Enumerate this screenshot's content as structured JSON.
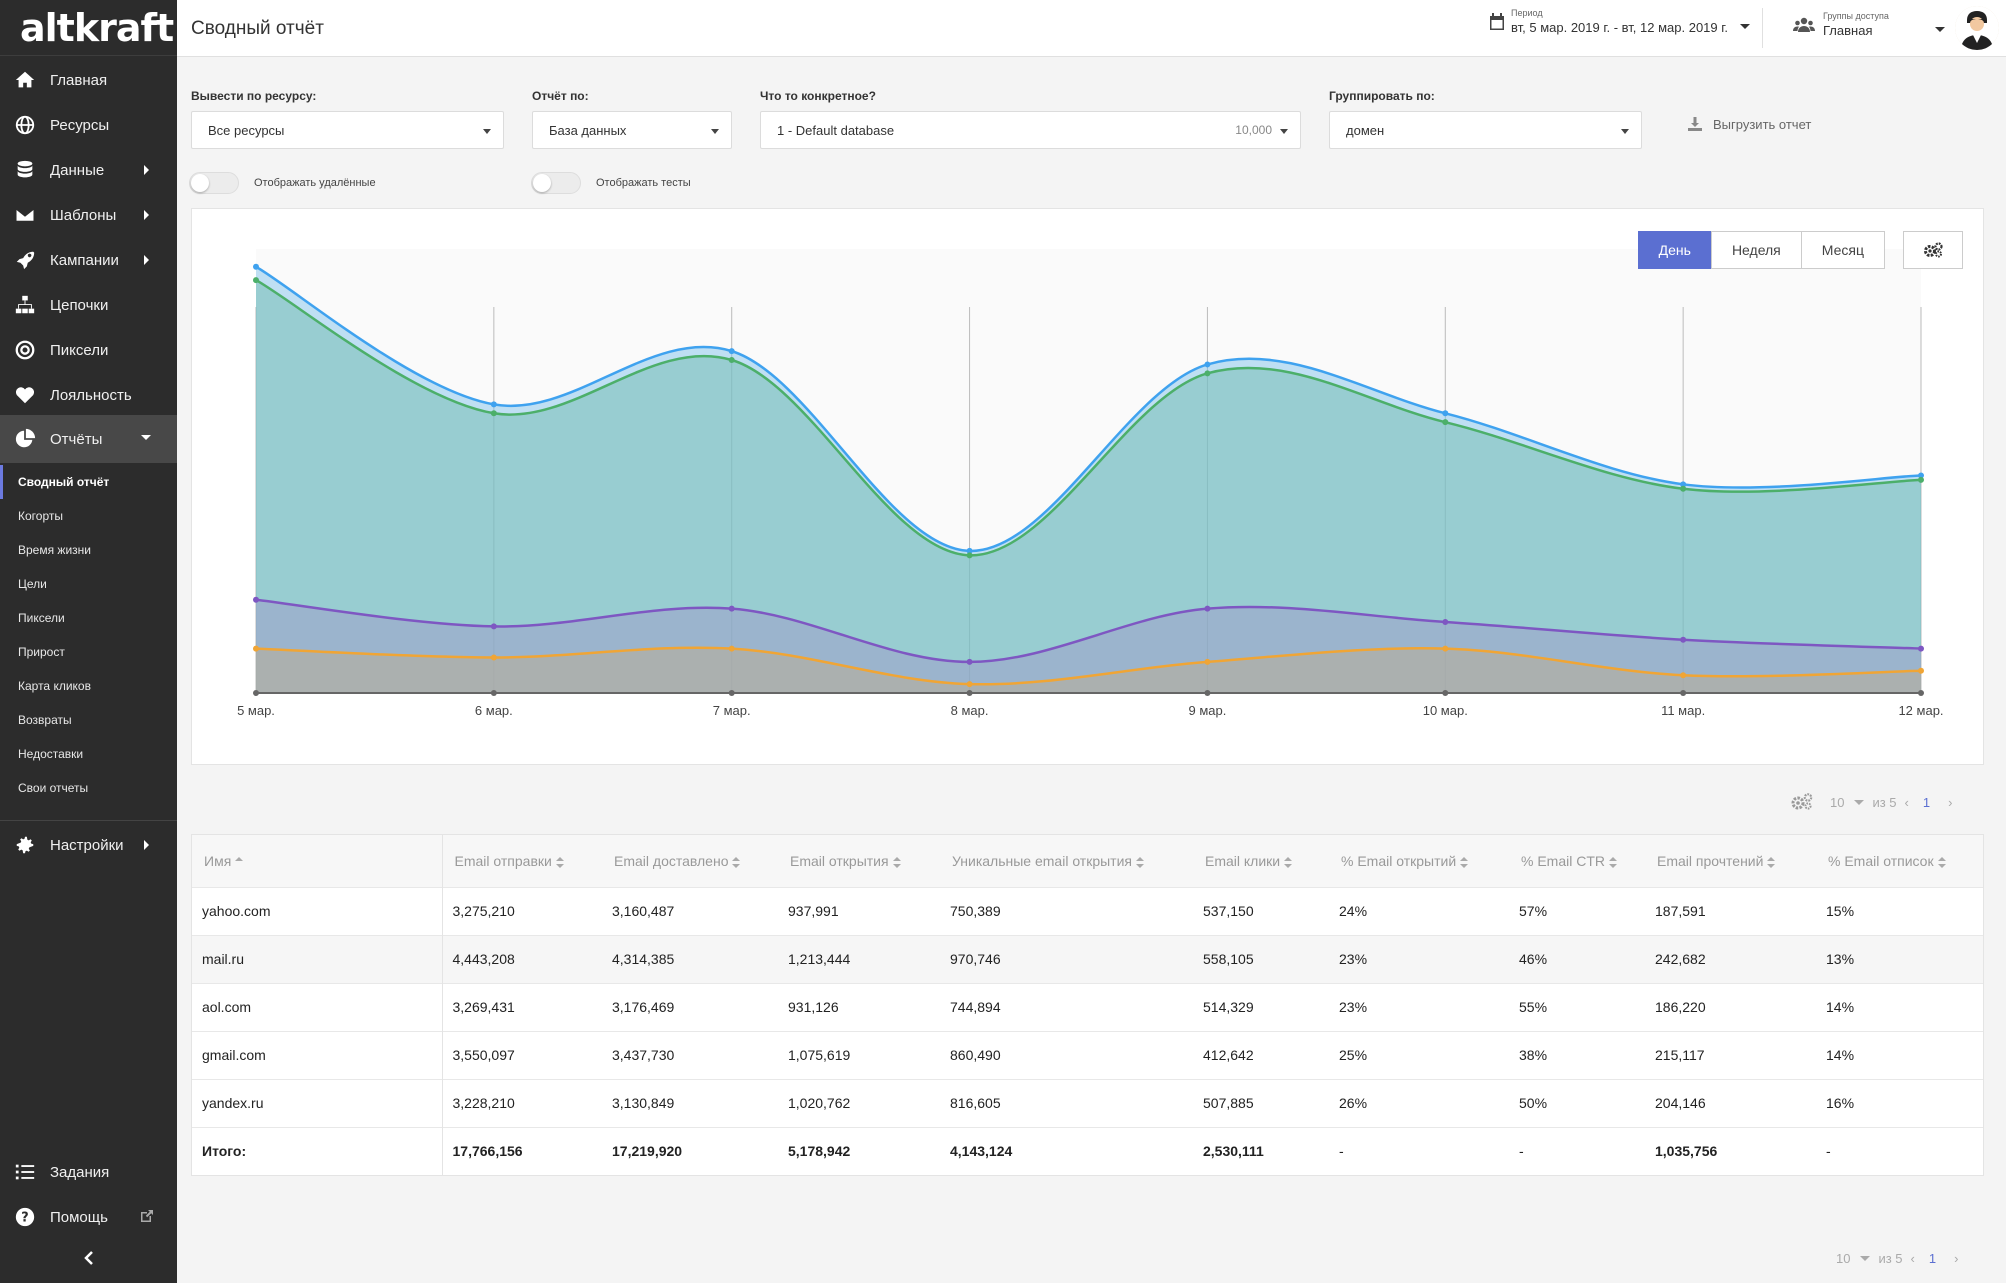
{
  "app": {
    "logo": "altkraft",
    "page_title": "Сводный отчёт"
  },
  "sidebar": {
    "items": [
      {
        "label": "Главная",
        "icon": "home-icon"
      },
      {
        "label": "Ресурсы",
        "icon": "globe-icon"
      },
      {
        "label": "Данные",
        "icon": "database-icon"
      },
      {
        "label": "Шаблоны",
        "icon": "envelope-icon"
      },
      {
        "label": "Кампании",
        "icon": "rocket-icon"
      },
      {
        "label": "Цепочки",
        "icon": "sitemap-icon"
      },
      {
        "label": "Пиксели",
        "icon": "target-icon"
      },
      {
        "label": "Лояльность",
        "icon": "heart-icon"
      },
      {
        "label": "Отчёты",
        "icon": "pie-chart-icon"
      }
    ],
    "sub_items": [
      "Сводный отчёт",
      "Когорты",
      "Время жизни",
      "Цели",
      "Пиксели",
      "Прирост",
      "Карта кликов",
      "Возвраты",
      "Недоставки",
      "Свои отчеты"
    ],
    "settings_label": "Настройки",
    "tasks_label": "Задания",
    "help_label": "Помощь"
  },
  "header": {
    "period_label": "Период",
    "period_value": "вт, 5 мар. 2019 г. - вт, 12 мар. 2019 г.",
    "access_label": "Группы доступа",
    "access_value": "Главная"
  },
  "filters": {
    "resource_label": "Вывести по ресурсу:",
    "resource_value": "Все ресурсы",
    "report_by_label": "Отчёт по:",
    "report_by_value": "База данных",
    "specific_label": "Что то конкретное?",
    "specific_value": "1 - Default database",
    "specific_count": "10,000",
    "group_label": "Группировать по:",
    "group_value": "домен",
    "export_label": "Выгрузить отчет",
    "show_deleted": "Отображать удалённые",
    "show_tests": "Отображать тесты"
  },
  "period_tabs": [
    "День",
    "Неделя",
    "Месяц"
  ],
  "colors": {
    "accent": "#5b6fd1",
    "blue": "#3fa2ef",
    "green": "#4caf6a",
    "purple": "#7e57c2",
    "orange": "#f0a535"
  },
  "chart_data": {
    "type": "area",
    "x": [
      "5 мар.",
      "6 мар.",
      "7 мар.",
      "8 мар.",
      "9 мар.",
      "10 мар.",
      "11 мар.",
      "12 мар."
    ],
    "series": [
      {
        "values": [
          9.6,
          6.5,
          7.7,
          3.2,
          7.4,
          6.3,
          4.7,
          4.9
        ],
        "color": "#3fa2ef"
      },
      {
        "values": [
          9.3,
          6.3,
          7.5,
          3.1,
          7.2,
          6.1,
          4.6,
          4.8
        ],
        "color": "#4caf6a"
      },
      {
        "values": [
          2.1,
          1.5,
          1.9,
          0.7,
          1.9,
          1.6,
          1.2,
          1.0
        ],
        "color": "#7e57c2"
      },
      {
        "values": [
          1.0,
          0.8,
          1.0,
          0.2,
          0.7,
          1.0,
          0.4,
          0.5
        ],
        "color": "#f0a535"
      }
    ]
  },
  "pager": {
    "per_page": "10",
    "of": "из 5",
    "page": "1"
  },
  "table": {
    "columns": [
      "Имя",
      "Email отправки",
      "Email доставлено",
      "Email открытия",
      "Уникальные email открытия",
      "Email клики",
      "% Email открытий",
      "% Email CTR",
      "Email прочтений",
      "% Email отписок"
    ],
    "rows": [
      [
        "yahoo.com",
        "3,275,210",
        "3,160,487",
        "937,991",
        "750,389",
        "537,150",
        "24%",
        "57%",
        "187,591",
        "15%"
      ],
      [
        "mail.ru",
        "4,443,208",
        "4,314,385",
        "1,213,444",
        "970,746",
        "558,105",
        "23%",
        "46%",
        "242,682",
        "13%"
      ],
      [
        "aol.com",
        "3,269,431",
        "3,176,469",
        "931,126",
        "744,894",
        "514,329",
        "23%",
        "55%",
        "186,220",
        "14%"
      ],
      [
        "gmail.com",
        "3,550,097",
        "3,437,730",
        "1,075,619",
        "860,490",
        "412,642",
        "25%",
        "38%",
        "215,117",
        "14%"
      ],
      [
        "yandex.ru",
        "3,228,210",
        "3,130,849",
        "1,020,762",
        "816,605",
        "507,885",
        "26%",
        "50%",
        "204,146",
        "16%"
      ]
    ],
    "total": [
      "Итого:",
      "17,766,156",
      "17,219,920",
      "5,178,942",
      "4,143,124",
      "2,530,111",
      "-",
      "-",
      "1,035,756",
      "-"
    ]
  }
}
